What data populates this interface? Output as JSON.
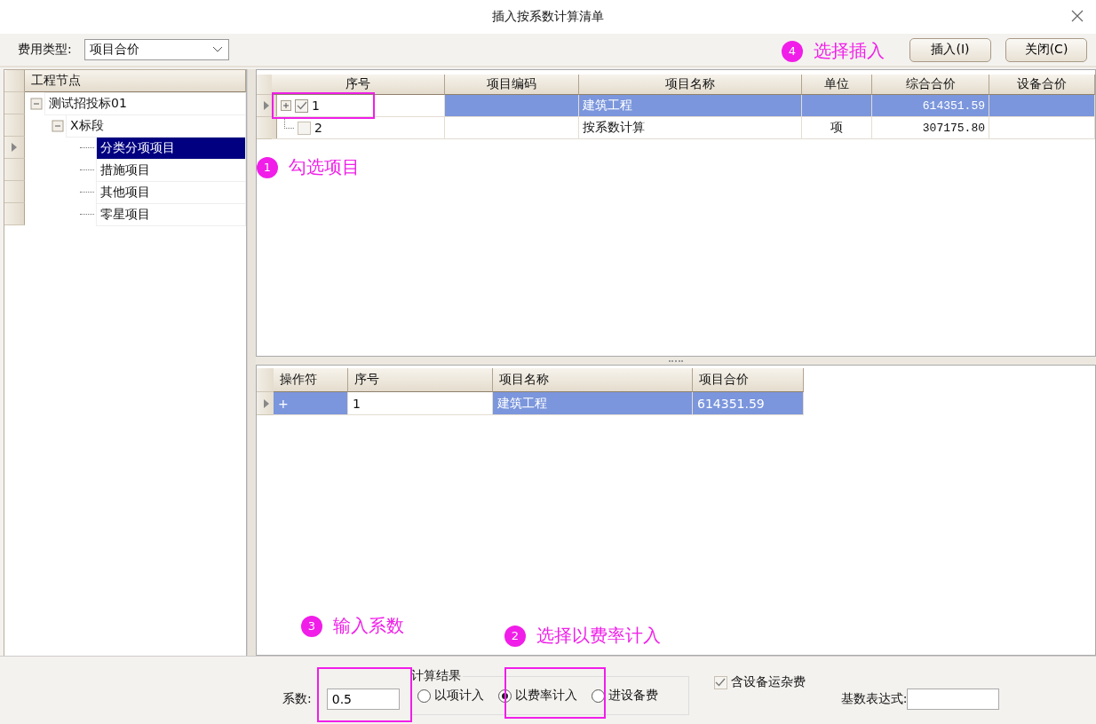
{
  "window": {
    "title": "插入按系数计算清单"
  },
  "toolbar": {
    "fee_type_label": "费用类型:",
    "fee_type_value": "项目合价",
    "buttons": [
      "插入(I)",
      "关闭(C)"
    ]
  },
  "tree": {
    "header": "工程节点",
    "items": [
      {
        "label": "测试招投标01",
        "expanded": true,
        "selected": false,
        "children": [
          {
            "label": "X标段",
            "expanded": true,
            "selected": false,
            "children": [
              {
                "label": "分类分项项目",
                "selected": true
              },
              {
                "label": "措施项目",
                "selected": false
              },
              {
                "label": "其他项目",
                "selected": false
              },
              {
                "label": "零星项目",
                "selected": false
              }
            ]
          }
        ]
      }
    ]
  },
  "list_grid": {
    "columns": [
      "序号",
      "项目编码",
      "项目名称",
      "单位",
      "综合合价",
      "设备合价"
    ],
    "rows": [
      {
        "kind": "group",
        "checked": true,
        "selected": true,
        "seq": "1",
        "name": "建筑工程",
        "total": "614351.59"
      },
      {
        "kind": "leaf",
        "checked": false,
        "selected": false,
        "seq": "2",
        "name": "按系数计算",
        "unit": "项",
        "total": "307175.80"
      }
    ]
  },
  "result_grid": {
    "columns": [
      "操作符",
      "序号",
      "项目名称",
      "项目合价"
    ],
    "rows": [
      {
        "selected": true,
        "operator": "+",
        "seq": "1",
        "name": "建筑工程",
        "price": "614351.59"
      }
    ]
  },
  "footer": {
    "coef_label": "系数:",
    "coef_value": "0.5",
    "group_title": "计算结果",
    "radios": [
      {
        "label": "以项计入",
        "selected": false
      },
      {
        "label": "以费率计入",
        "selected": true
      },
      {
        "label": "进设备费",
        "selected": false
      }
    ],
    "checkbox": {
      "label": "含设备运杂费",
      "checked": true
    },
    "base_expr_label": "基数表达式:"
  },
  "annotations": [
    {
      "number": "4",
      "text": "选择插入"
    },
    {
      "number": "1",
      "text": "勾选项目"
    },
    {
      "number": "3",
      "text": "输入系数"
    },
    {
      "number": "2",
      "text": "选择以费率计入"
    }
  ]
}
